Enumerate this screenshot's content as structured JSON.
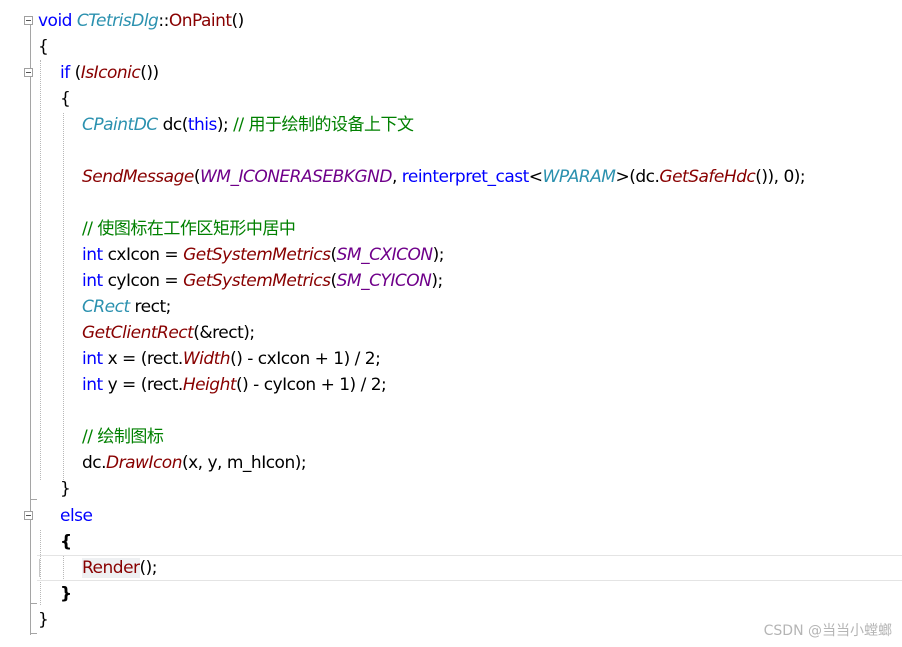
{
  "code": {
    "l1_kw": "void",
    "l1_cls": "CTetrisDlg",
    "l1_sep": "::",
    "l1_fn": "OnPaint",
    "l1_paren": "()",
    "l2": "{",
    "l3_kw": "if",
    "l3_a": " (",
    "l3_fn": "IsIconic",
    "l3_b": "())",
    "l4": "{",
    "l5_ty": "CPaintDC",
    "l5_a": " dc(",
    "l5_kw": "this",
    "l5_b": "); ",
    "l5_cm": "// 用于绘制的设备上下文",
    "l7_fn": "SendMessage",
    "l7_a": "(",
    "l7_mc": "WM_ICONERASEBKGND",
    "l7_b": ", ",
    "l7_kw": "reinterpret_cast",
    "l7_c": "<",
    "l7_ty": "WPARAM",
    "l7_d": ">(dc.",
    "l7_fn2": "GetSafeHdc",
    "l7_e": "()), 0);",
    "l9_cm": "// 使图标在工作区矩形中居中",
    "l10_kw": "int",
    "l10_a": " cxIcon = ",
    "l10_fn": "GetSystemMetrics",
    "l10_b": "(",
    "l10_mc": "SM_CXICON",
    "l10_c": ");",
    "l11_kw": "int",
    "l11_a": " cyIcon = ",
    "l11_fn": "GetSystemMetrics",
    "l11_b": "(",
    "l11_mc": "SM_CYICON",
    "l11_c": ");",
    "l12_ty": "CRect",
    "l12_a": " rect;",
    "l13_fn": "GetClientRect",
    "l13_a": "(&rect);",
    "l14_kw": "int",
    "l14_a": " x = (rect.",
    "l14_fn": "Width",
    "l14_b": "() - cxIcon + 1) / 2;",
    "l15_kw": "int",
    "l15_a": " y = (rect.",
    "l15_fn": "Height",
    "l15_b": "() - cyIcon + 1) / 2;",
    "l17_cm": "// 绘制图标",
    "l18_a": "dc.",
    "l18_fn": "DrawIcon",
    "l18_b": "(x, y, m_hIcon);",
    "l19": "}",
    "l20_kw": "else",
    "l21": "{",
    "l22_fn": "Render",
    "l22_a": "();",
    "l23": "}",
    "l24": "}"
  },
  "watermark": "CSDN @当当小螳螂",
  "colors": {
    "keyword": "#0000ff",
    "type": "#2b91af",
    "function": "#880000",
    "macro": "#6f008a",
    "comment": "#008000"
  }
}
